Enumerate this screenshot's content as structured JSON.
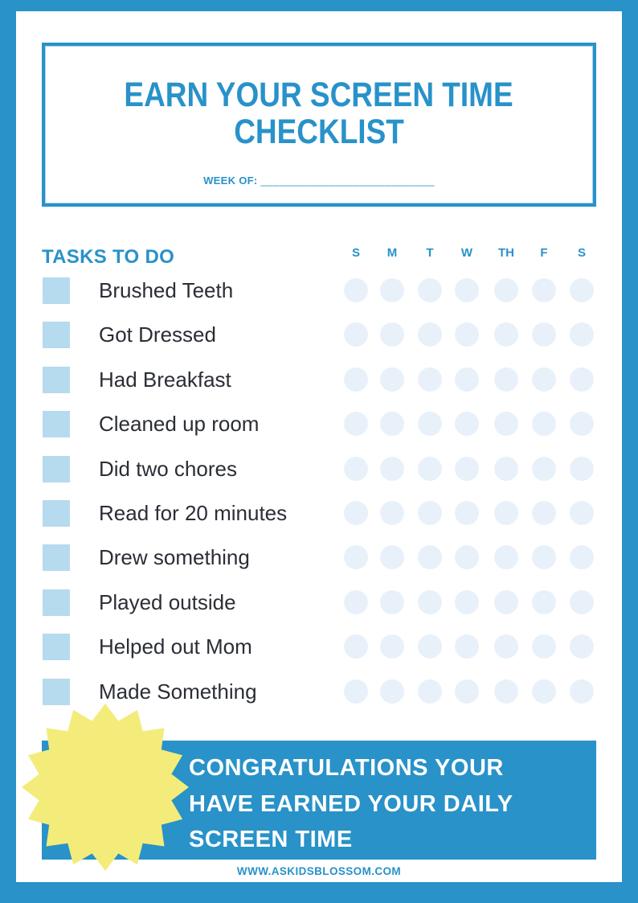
{
  "header": {
    "title_line1": "EARN YOUR SCREEN TIME",
    "title_line2": "CHECKLIST",
    "week_label": "WEEK OF:",
    "week_blank": "____________________________"
  },
  "checklist": {
    "heading": "TASKS TO DO",
    "days": [
      "S",
      "M",
      "T",
      "W",
      "TH",
      "F",
      "S"
    ],
    "tasks": [
      {
        "label": "Brushed Teeth"
      },
      {
        "label": "Got Dressed"
      },
      {
        "label": "Had Breakfast"
      },
      {
        "label": "Cleaned up room"
      },
      {
        "label": "Did two chores"
      },
      {
        "label": "Read for 20 minutes"
      },
      {
        "label": "Drew something"
      },
      {
        "label": "Played outside"
      },
      {
        "label": "Helped out Mom"
      },
      {
        "label": "Made Something"
      }
    ]
  },
  "banner": {
    "line1": "CONGRATULATIONS YOUR",
    "line2": "HAVE EARNED YOUR DAILY",
    "line3": "SCREEN TIME",
    "star_icon": "starburst"
  },
  "footer": {
    "website": "WWW.ASKIDSBLOSSOM.COM"
  },
  "colors": {
    "brand_blue": "#2892c9",
    "checkbox_blue": "#b6daee",
    "dot_blue": "#e8f1fa",
    "star_yellow": "#f3ec7a",
    "text_dark": "#2b2e36"
  }
}
